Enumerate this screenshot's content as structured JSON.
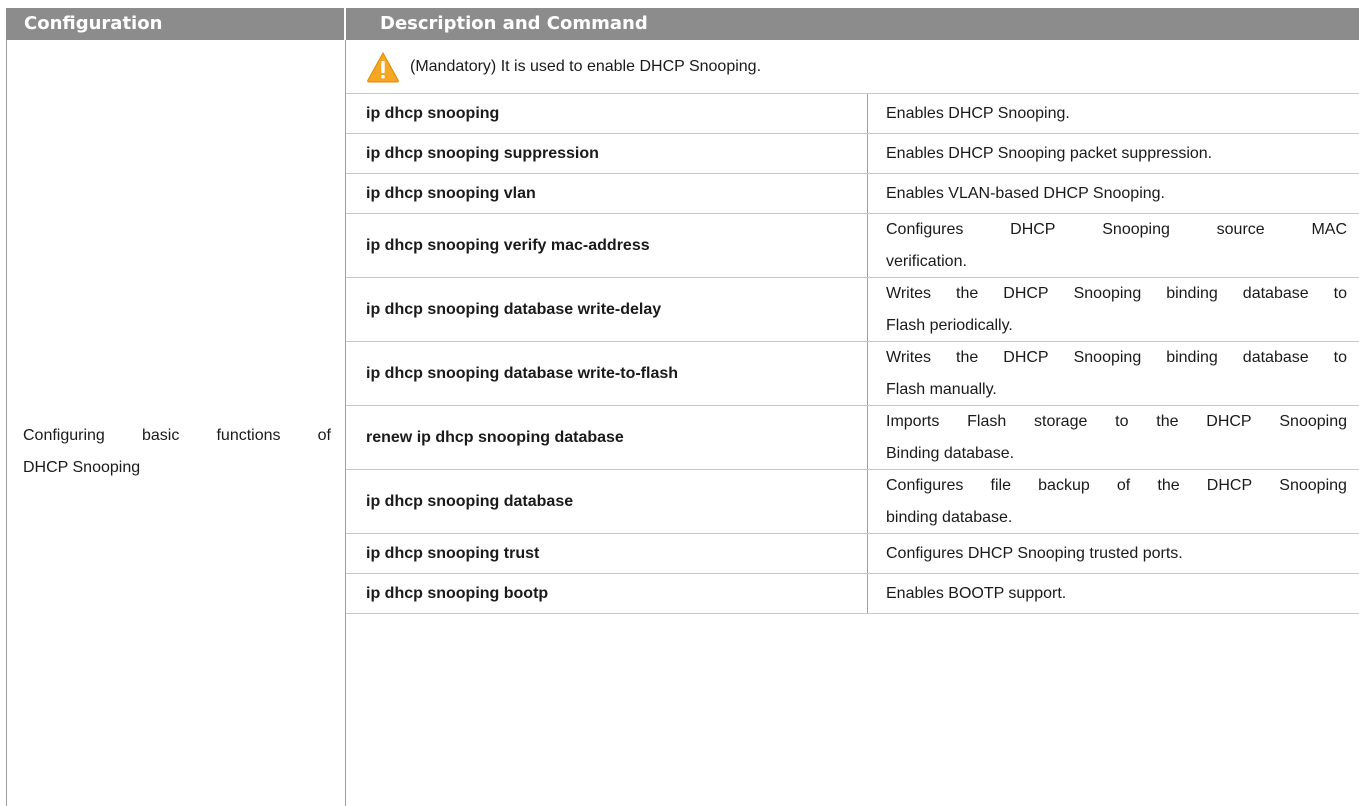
{
  "table": {
    "headers": {
      "configuration": "Configuration",
      "description": "Description and Command"
    },
    "configuration_lines": [
      [
        "Configuring",
        "basic",
        "functions",
        "of"
      ],
      "DHCP Snooping"
    ],
    "note": {
      "icon": "warning-icon",
      "text": "(Mandatory) It is used to enable DHCP Snooping."
    },
    "rows": [
      {
        "command": "ip dhcp snooping",
        "description": [
          "Enables DHCP Snooping."
        ]
      },
      {
        "command": "ip dhcp snooping suppression",
        "description": [
          "Enables DHCP Snooping packet suppression."
        ]
      },
      {
        "command": "ip dhcp snooping vlan",
        "description": [
          "Enables VLAN-based DHCP Snooping."
        ]
      },
      {
        "command": "ip dhcp snooping verify mac-address",
        "description": [
          [
            "Configures",
            "DHCP",
            "Snooping",
            "source",
            "MAC"
          ],
          "verification."
        ]
      },
      {
        "command": "ip dhcp snooping database write-delay",
        "description": [
          [
            "Writes",
            "the",
            "DHCP",
            "Snooping",
            "binding",
            "database",
            "to"
          ],
          "Flash periodically."
        ]
      },
      {
        "command": "ip dhcp snooping database write-to-flash",
        "description": [
          [
            "Writes",
            "the",
            "DHCP",
            "Snooping",
            "binding",
            "database",
            "to"
          ],
          "Flash manually."
        ]
      },
      {
        "command": "renew ip dhcp snooping database",
        "description": [
          [
            "Imports",
            "Flash",
            "storage",
            "to",
            "the",
            "DHCP",
            "Snooping"
          ],
          "Binding database."
        ]
      },
      {
        "command": "ip dhcp snooping database",
        "description": [
          [
            "Configures",
            "file",
            "backup",
            "of",
            "the",
            "DHCP",
            "Snooping"
          ],
          "binding database."
        ]
      },
      {
        "command": "ip dhcp snooping trust",
        "description": [
          "Configures DHCP Snooping trusted ports."
        ]
      },
      {
        "command": "ip dhcp snooping bootp",
        "description": [
          "Enables BOOTP support."
        ]
      }
    ],
    "colors": {
      "header_bg": "#8c8c8c",
      "header_text": "#ffffff",
      "warning_fill": "#f5a623"
    }
  }
}
